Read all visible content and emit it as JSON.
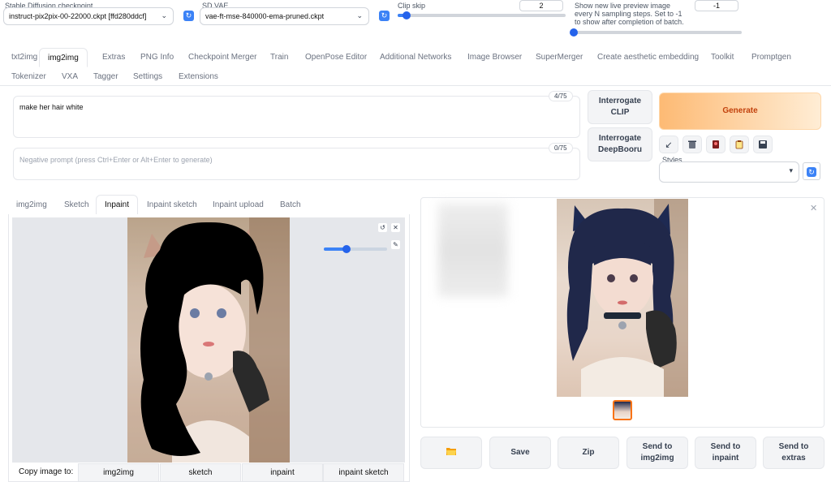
{
  "settings": {
    "checkpoint": {
      "label": "Stable Diffusion checkpoint",
      "value": "instruct-pix2pix-00-22000.ckpt [ffd280ddcf]"
    },
    "vae": {
      "label": "SD VAE",
      "value": "vae-ft-mse-840000-ema-pruned.ckpt"
    },
    "clip_skip": {
      "label": "Clip skip",
      "value": "2",
      "level": 0.05
    },
    "live_preview": {
      "label": "Show new live preview image every N sampling steps. Set to -1 to show after completion of batch.",
      "value": "-1",
      "level": 0.0
    }
  },
  "nav": {
    "row1": [
      "txt2img",
      "img2img",
      "Extras",
      "PNG Info",
      "Checkpoint Merger",
      "Train",
      "OpenPose Editor",
      "Additional Networks",
      "Image Browser",
      "SuperMerger",
      "Create aesthetic embedding",
      "Toolkit",
      "Promptgen"
    ],
    "row2": [
      "Tokenizer",
      "VXA",
      "Tagger",
      "Settings",
      "Extensions"
    ],
    "active": "img2img"
  },
  "prompt": {
    "value": "make her hair white",
    "counter": "4/75"
  },
  "negative": {
    "placeholder": "Negative prompt (press Ctrl+Enter or Alt+Enter to generate)",
    "counter": "0/75"
  },
  "interrogate": {
    "clip": "Interrogate\nCLIP",
    "deepbooru": "Interrogate\nDeepBooru"
  },
  "generate": {
    "label": "Generate",
    "color": "#f97316"
  },
  "styles": {
    "label": "Styles"
  },
  "subtabs": {
    "items": [
      "img2img",
      "Sketch",
      "Inpaint",
      "Inpaint sketch",
      "Inpaint upload",
      "Batch"
    ],
    "active": "Inpaint"
  },
  "brush": {
    "level": 0.35
  },
  "copy": {
    "label": "Copy image to:",
    "targets": [
      "img2img",
      "sketch",
      "inpaint",
      "inpaint sketch"
    ]
  },
  "output_actions": [
    "Save",
    "Zip",
    "Send to img2img",
    "Send to inpaint",
    "Send to extras"
  ],
  "icons": [
    "arrow-icon",
    "trash-icon",
    "card-icon",
    "clipboard-icon",
    "save-icon",
    "folder-icon",
    "close-icon",
    "undo-icon",
    "clear-icon",
    "brush-icon"
  ]
}
